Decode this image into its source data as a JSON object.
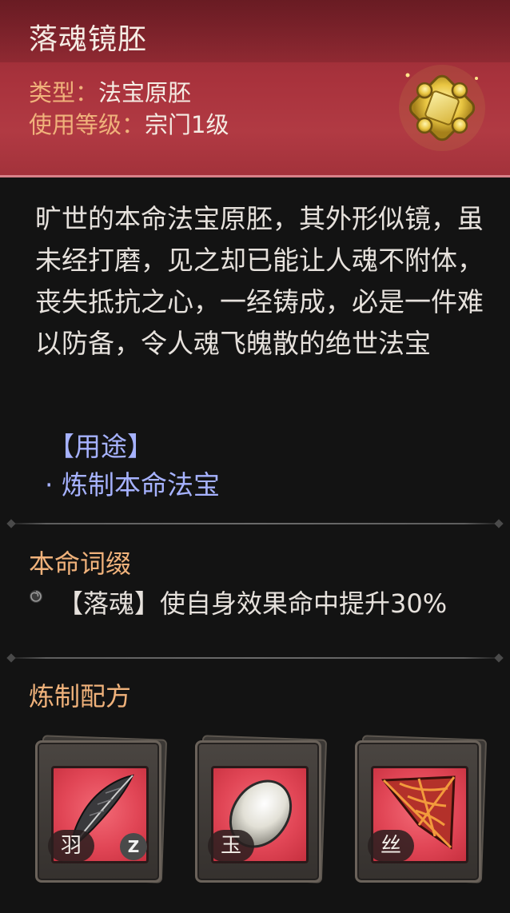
{
  "item": {
    "name": "落魂镜胚",
    "type_label": "类型：",
    "type_value": "法宝原胚",
    "level_label": "使用等级：",
    "level_value": "宗门1级",
    "icon": "golden-mirror-icon"
  },
  "description": "旷世的本命法宝原胚，其外形似镜，虽未经打磨，见之却已能让人魂不附体，丧失抵抗之心，一经铸成，必是一件难以防备，令人魂飞魄散的绝世法宝",
  "usage": {
    "heading": "【用途】",
    "items": [
      "· 炼制本命法宝"
    ]
  },
  "affix_section": {
    "title": "本命词缀",
    "entry": "【落魂】使自身效果命中提升30%"
  },
  "recipe_section": {
    "title": "炼制配方",
    "materials": [
      {
        "label": "羽",
        "icon": "feather-icon"
      },
      {
        "label": "玉",
        "icon": "jade-stone-icon"
      },
      {
        "label": "丝",
        "icon": "spider-web-icon"
      }
    ]
  },
  "badge": "Z",
  "colors": {
    "header_red": "#a8323c",
    "key_orange": "#f0b27b",
    "usage_blue": "#a6b2ff",
    "body_text": "#e6e1dc",
    "background": "#131313"
  }
}
